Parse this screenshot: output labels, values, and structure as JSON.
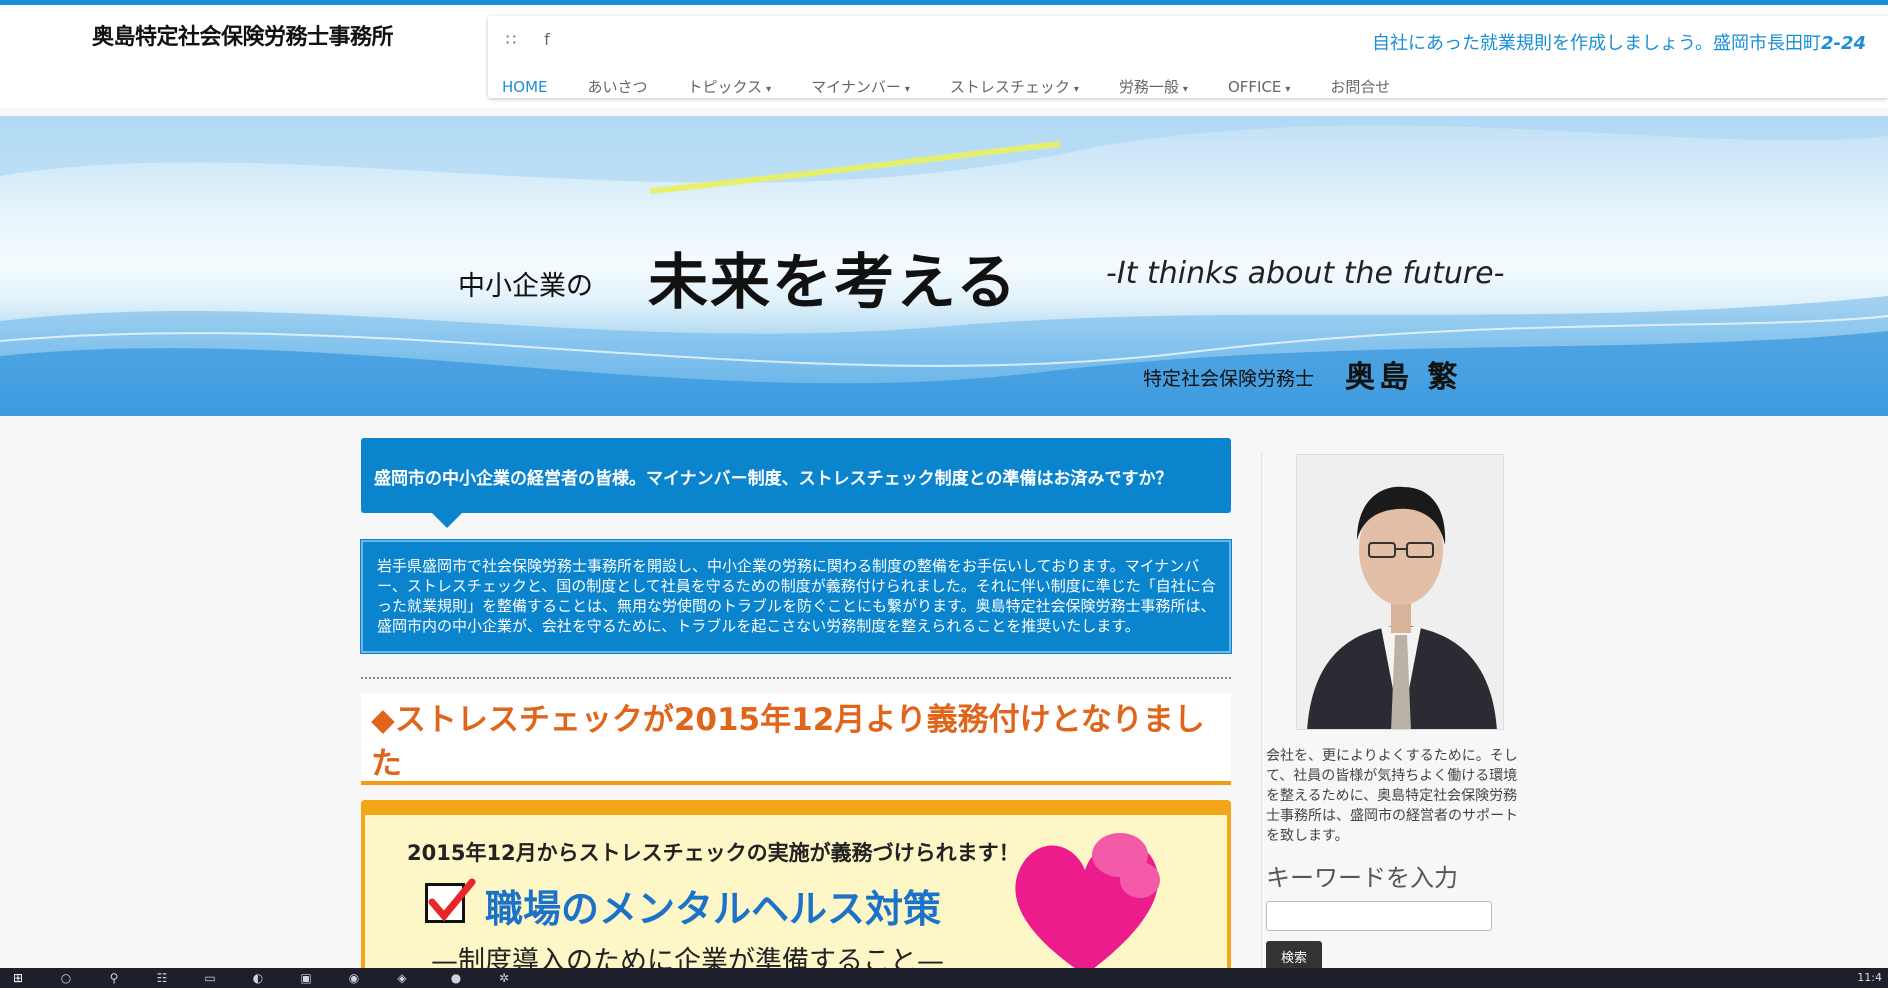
{
  "header": {
    "site_title": "奥島特定社会保険労務士事務所",
    "tagline_text": "自社にあった就業規則を作成しましょう。盛岡市長田町",
    "tagline_address": "2-24",
    "social": [
      {
        "icon": "rss-icon",
        "glyph": "∷"
      },
      {
        "icon": "facebook-icon",
        "glyph": "f"
      }
    ],
    "menu": [
      {
        "label": "HOME",
        "dropdown": false,
        "active": true
      },
      {
        "label": "あいさつ",
        "dropdown": false
      },
      {
        "label": "トピックス",
        "dropdown": true
      },
      {
        "label": "マイナンバー",
        "dropdown": true
      },
      {
        "label": "ストレスチェック",
        "dropdown": true
      },
      {
        "label": "労務一般",
        "dropdown": true
      },
      {
        "label": "OFFICE",
        "dropdown": true
      },
      {
        "label": "お問合せ",
        "dropdown": false
      }
    ],
    "caret": "▾"
  },
  "banner": {
    "small": "中小企業の",
    "large": "未来を考える",
    "english": "-It thinks about the future-",
    "role": "特定社会保険労務士",
    "name": "奥島 繁"
  },
  "main": {
    "callout": "盛岡市の中小企業の経営者の皆様。マイナンバー制度、ストレスチェック制度との準備はお済みですか？",
    "intro": "岩手県盛岡市で社会保険労務士事務所を開設し、中小企業の労務に関わる制度の整備をお手伝いしております。マイナンバー、ストレスチェックと、国の制度として社員を守るための制度が義務付けられました。それに伴い制度に準じた「自社に合った就業規則」を整備することは、無用な労使間のトラブルを防ぐことにも繋がります。奥島特定社会保険労務士事務所は、盛岡市内の中小企業が、会社を守るために、トラブルを起こさない労務制度を整えられることを推奨いたします。",
    "post_title": "◆ストレスチェックが2015年12月より義務付けとなりました",
    "feature": {
      "line1": "2015年12月からストレスチェックの実施が義務づけられます！",
      "line2": "職場のメンタルヘルス対策",
      "line3": "—制度導入のために企業が準備すること—"
    }
  },
  "sidebar": {
    "text": "会社を、更によりよくするために。そして、社員の皆様が気持ちよく働ける環境を整えるために、奥島特定社会保険労務士事務所は、盛岡市の経営者のサポートを致します。",
    "keyword_label": "キーワードを入力",
    "search_value": "",
    "search_button": "検索"
  },
  "taskbar": {
    "clock": "11:4"
  }
}
